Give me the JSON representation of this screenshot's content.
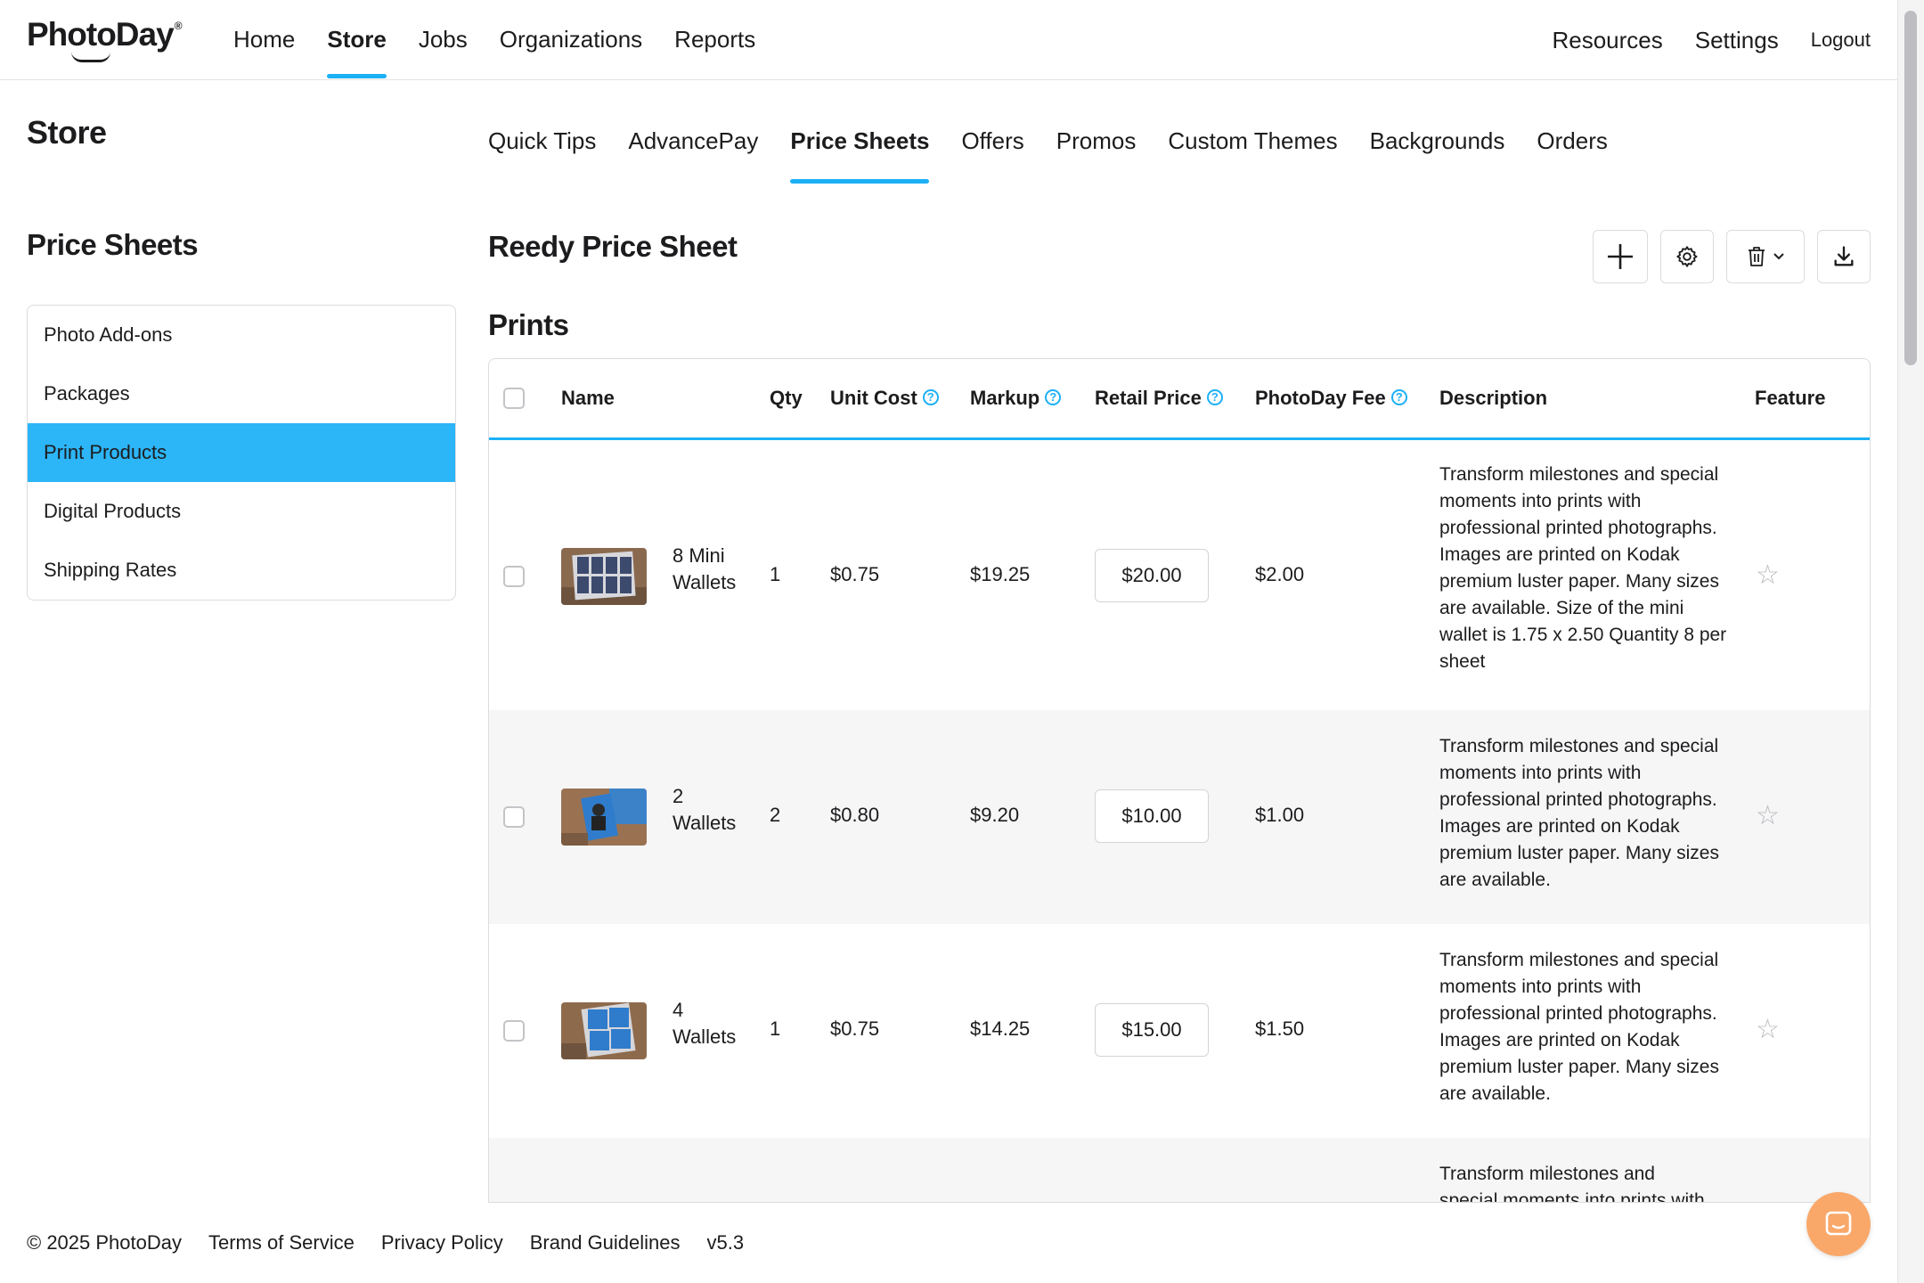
{
  "brand": {
    "name": "PhotoDay",
    "tm": "®"
  },
  "nav": {
    "links": [
      "Home",
      "Store",
      "Jobs",
      "Organizations",
      "Reports"
    ],
    "active": "Store",
    "right": {
      "resources": "Resources",
      "settings": "Settings",
      "logout": "Logout"
    }
  },
  "page": {
    "title": "Store"
  },
  "subnav": {
    "tabs": [
      "Quick Tips",
      "AdvancePay",
      "Price Sheets",
      "Offers",
      "Promos",
      "Custom Themes",
      "Backgrounds",
      "Orders"
    ],
    "active": "Price Sheets"
  },
  "sidebar": {
    "title": "Price Sheets",
    "items": [
      "Photo Add-ons",
      "Packages",
      "Print Products",
      "Digital Products",
      "Shipping Rates"
    ],
    "active": "Print Products"
  },
  "main": {
    "sheet_title": "Reedy Price Sheet",
    "toolbar_icons": [
      "plus-icon",
      "gear-icon",
      "trash-icon",
      "chevron-down-icon",
      "download-icon"
    ],
    "section_title": "Prints",
    "columns": {
      "name": "Name",
      "qty": "Qty",
      "unit_cost": "Unit Cost",
      "markup": "Markup",
      "retail_price": "Retail Price",
      "photoday_fee": "PhotoDay Fee",
      "description": "Description",
      "feature": "Feature"
    },
    "help_glyph": "?",
    "rows": [
      {
        "name_line1": "8 Mini",
        "name_line2": "Wallets",
        "qty": "1",
        "unit_cost": "$0.75",
        "markup": "$19.25",
        "retail_price": "$20.00",
        "fee": "$2.00",
        "description": "Transform milestones and special moments into prints with professional printed photographs. Images are printed on Kodak premium luster paper. Many sizes are available. Size of the mini wallet is 1.75 x 2.50 Quantity 8 per sheet"
      },
      {
        "name_line1": "2",
        "name_line2": "Wallets",
        "qty": "2",
        "unit_cost": "$0.80",
        "markup": "$9.20",
        "retail_price": "$10.00",
        "fee": "$1.00",
        "description": "Transform milestones and special moments into prints with professional printed photographs. Images are printed on Kodak premium luster paper. Many sizes are available."
      },
      {
        "name_line1": "4",
        "name_line2": "Wallets",
        "qty": "1",
        "unit_cost": "$0.75",
        "markup": "$14.25",
        "retail_price": "$15.00",
        "fee": "$1.50",
        "description": "Transform milestones and special moments into prints with professional printed photographs. Images are printed on Kodak premium luster paper. Many sizes are available."
      },
      {
        "description": "Transform milestones and special moments into prints with"
      }
    ]
  },
  "footer": {
    "copyright": "© 2025 PhotoDay",
    "links": [
      "Terms of Service",
      "Privacy Policy",
      "Brand Guidelines"
    ],
    "version": "v5.3"
  },
  "colors": {
    "accent": "#1cb0f6",
    "sidebar_active": "#2cb5f7",
    "chat": "#f9a86a"
  }
}
